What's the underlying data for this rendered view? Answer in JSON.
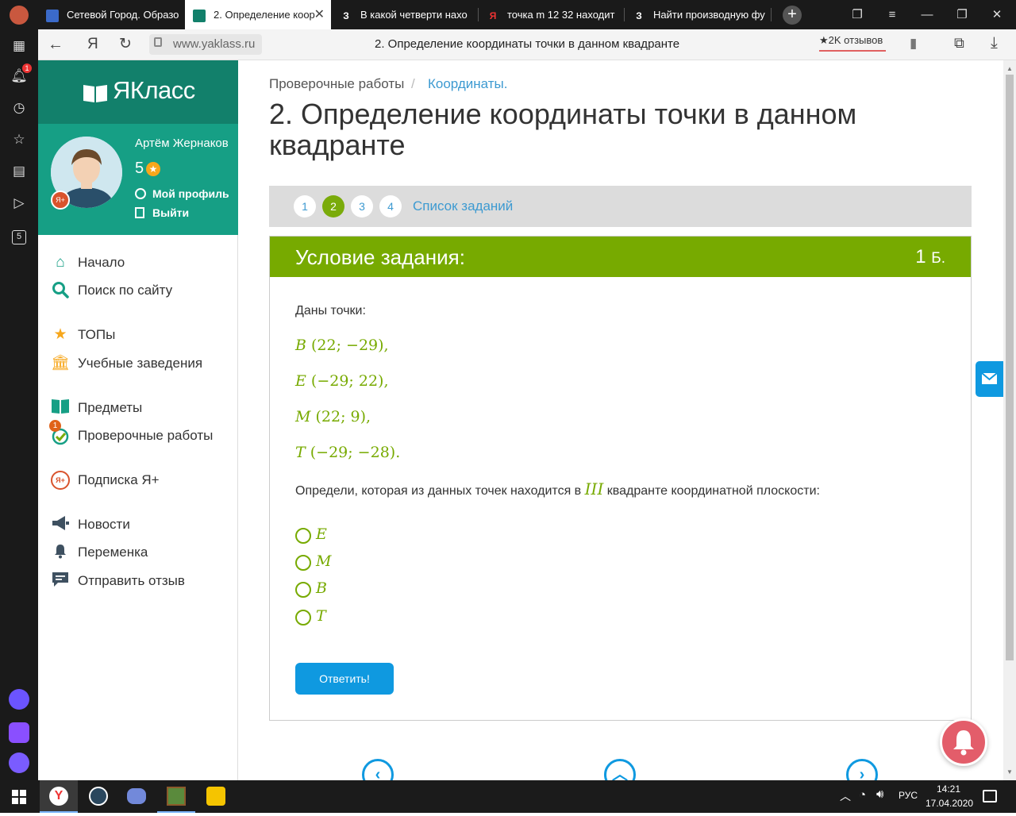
{
  "browser": {
    "tabs": [
      {
        "label": "Сетевой Город. Образо",
        "icon_text": "",
        "active": false
      },
      {
        "label": "2. Определение коор",
        "icon_text": "",
        "active": true
      },
      {
        "label": "В какой четверти нахо",
        "icon_text": "З",
        "active": false
      },
      {
        "label": "точка m 12 32 находит",
        "icon_text": "Я",
        "active": false
      },
      {
        "label": "Найти производную фу",
        "icon_text": "З",
        "active": false
      }
    ],
    "address": {
      "domain": "www.yaklass.ru",
      "page_title": "2. Определение координаты точки в данном квадранте",
      "reviews_badge": "2K отзывов"
    },
    "sidebar_badge_count": "1",
    "sidebar_icon_count_label": "5",
    "colors": {
      "tabbar": "#1a1a1a",
      "accent_green": "#77aa00",
      "teal": "#169f85",
      "blue": "#0f99e0"
    }
  },
  "site": {
    "logo": "ЯКласс",
    "user": {
      "name": "Артём Жернаков",
      "points": "5",
      "profile_link": "Мой профиль",
      "logout_link": "Выйти"
    },
    "nav": [
      {
        "label": "Начало",
        "icon": "home-icon"
      },
      {
        "label": "Поиск по сайту",
        "icon": "search-icon"
      },
      {
        "label": "ТОПы",
        "icon": "star-icon"
      },
      {
        "label": "Учебные заведения",
        "icon": "institution-icon"
      },
      {
        "label": "Предметы",
        "icon": "books-icon"
      },
      {
        "label": "Проверочные работы",
        "icon": "check-icon",
        "badge": "1"
      },
      {
        "label": "Подписка Я+",
        "icon": "subscription-icon"
      },
      {
        "label": "Новости",
        "icon": "megaphone-icon"
      },
      {
        "label": "Переменка",
        "icon": "bell-icon"
      },
      {
        "label": "Отправить отзыв",
        "icon": "comment-icon"
      }
    ]
  },
  "main": {
    "breadcrumb": {
      "first": "Проверочные работы",
      "separator": "/",
      "second": "Координаты."
    },
    "title": "2. Определение координаты точки в данном квадранте",
    "task_numbers": [
      "1",
      "2",
      "3",
      "4"
    ],
    "current_task": "2",
    "task_list_link": "Список заданий",
    "task_header": "Условие задания:",
    "task_score": "1",
    "task_score_unit": "Б.",
    "intro": "Даны точки:",
    "points": [
      {
        "letter": "B",
        "coords": "(22; −29),"
      },
      {
        "letter": "E",
        "coords": "(−29; 22),"
      },
      {
        "letter": "M",
        "coords": "(22; 9),"
      },
      {
        "letter": "T",
        "coords": "(−29; −28)."
      }
    ],
    "question_before": "Определи, которая из данных точек находится в",
    "quadrant": "III",
    "question_after": "квадранте координатной плоскости:",
    "options": [
      "E",
      "M",
      "B",
      "T"
    ],
    "answer_button": "Ответить!"
  },
  "taskbar": {
    "lang": "РУС",
    "time": "14:21",
    "date": "17.04.2020"
  }
}
